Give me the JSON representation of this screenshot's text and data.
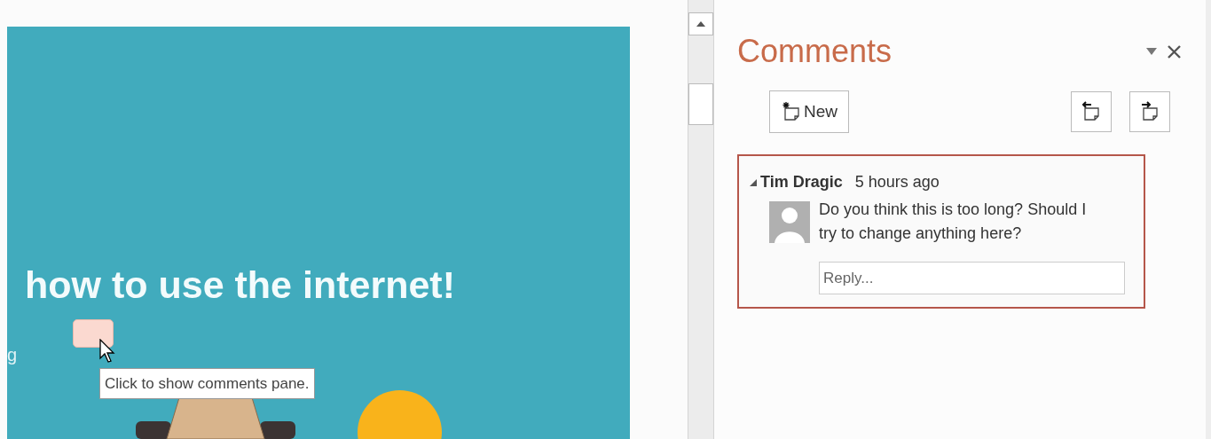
{
  "slide": {
    "title": "how to use the internet!",
    "side_text": "g",
    "comment_marker": {
      "tooltip": "Click to show comments pane."
    }
  },
  "comments_pane": {
    "title": "Comments",
    "new_button": "New",
    "comments": [
      {
        "author": "Tim Dragic",
        "time": "5 hours ago",
        "expanded": true,
        "text": "Do you think this is too long? Should I try to change anything here?",
        "reply": {
          "placeholder": "Reply..."
        }
      }
    ]
  }
}
